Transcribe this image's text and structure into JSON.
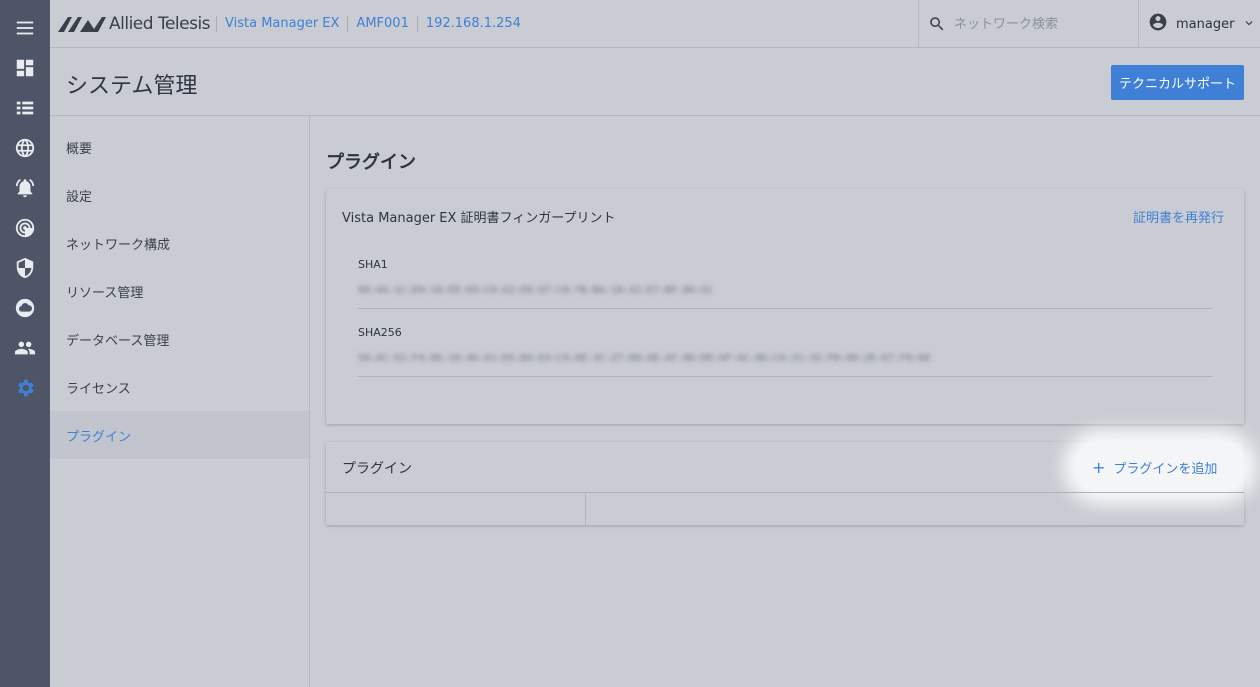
{
  "brand": {
    "name": "Allied Telesis"
  },
  "breadcrumbs": [
    "Vista Manager EX",
    "AMF001",
    "192.168.1.254"
  ],
  "search": {
    "placeholder": "ネットワーク検索"
  },
  "user": {
    "name": "manager"
  },
  "rail": [
    {
      "icon": "menu-icon"
    },
    {
      "icon": "dashboard-icon"
    },
    {
      "icon": "list-icon"
    },
    {
      "icon": "globe-icon"
    },
    {
      "icon": "alarm-icon"
    },
    {
      "icon": "radar-icon"
    },
    {
      "icon": "shield-icon"
    },
    {
      "icon": "cloud-icon"
    },
    {
      "icon": "people-icon"
    },
    {
      "icon": "gear-icon",
      "active": true
    }
  ],
  "page": {
    "title": "システム管理",
    "support_button": "テクニカルサポート"
  },
  "nav": [
    {
      "label": "概要"
    },
    {
      "label": "設定"
    },
    {
      "label": "ネットワーク構成"
    },
    {
      "label": "リソース管理"
    },
    {
      "label": "データベース管理"
    },
    {
      "label": "ライセンス"
    },
    {
      "label": "プラグイン",
      "active": true
    }
  ],
  "main": {
    "section_title": "プラグイン",
    "cert_card": {
      "title": "Vista Manager EX 証明書フィンガープリント",
      "reissue_link": "証明書を再発行",
      "sha1_label": "SHA1",
      "sha1_value": "60:4A:1C:D9:10:EE:69:C0:A2:D9:97:C8:7B:BA:18:42:E7:BF:86:5C",
      "sha256_label": "SHA256",
      "sha256_value": "50:AC:52:F4:66:16:46:A1:D5:B4:D3:C9:AE:3C:27:08:AE:AF:0D:DE:6F:AC:0D:C6:31:32:FB:48:2E:67:F9:60"
    },
    "plugin_card": {
      "title": "プラグイン",
      "add_button": "プラグインを追加"
    }
  },
  "colors": {
    "accent": "#3f7fd6",
    "rail": "#4d5566",
    "background": "#c9ccd3"
  }
}
